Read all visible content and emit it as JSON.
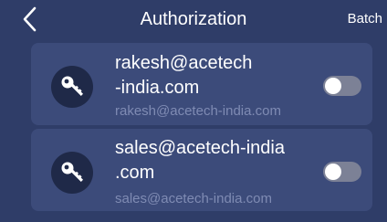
{
  "header": {
    "title": "Authorization",
    "batch_label": "Batch",
    "back_icon": "chevron-left-icon"
  },
  "accounts": [
    {
      "name_line1": "rakesh@acetech",
      "name_line2": "-india.com",
      "subtitle": "rakesh@acetech-india.com",
      "icon": "key-icon",
      "enabled": false
    },
    {
      "name_line1": "sales@acetech-india",
      "name_line2": ".com",
      "subtitle": "sales@acetech-india.com",
      "icon": "key-icon",
      "enabled": false
    }
  ],
  "colors": {
    "background": "#2f3d68",
    "card": "#3c4b7a",
    "subtitle": "#7f8bb3",
    "toggle_off": "#7c8196"
  }
}
